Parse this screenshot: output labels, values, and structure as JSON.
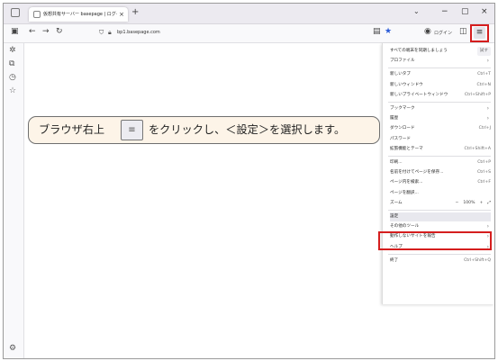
{
  "browser": {
    "tab_title": "仮想共有サーバー basepage | ログイン",
    "tab_close": "×",
    "new_tab": "+",
    "list_tabs_icon": "chevron-down-icon",
    "window_controls": [
      "−",
      "▢",
      "×"
    ],
    "url": "bp1.basepage.com",
    "account_label": "ログイン",
    "menu_icon": "≡"
  },
  "sidebar": {
    "icons": [
      "sparkle-icon",
      "tabs-sync-icon",
      "history-icon",
      "bookmark-star-icon"
    ],
    "bottom_icon": "gear-icon"
  },
  "menu": {
    "items": [
      {
        "label": "すべての端末を同期しましょう",
        "shortcut": "試す"
      },
      {
        "label": "プロファイル",
        "chevron": true
      },
      {
        "sep": true
      },
      {
        "label": "新しいタブ",
        "shortcut": "Ctrl+T"
      },
      {
        "label": "新しいウィンドウ",
        "shortcut": "Ctrl+N"
      },
      {
        "label": "新しいプライベートウィンドウ",
        "shortcut": "Ctrl+Shift+P"
      },
      {
        "sep": true
      },
      {
        "label": "ブックマーク",
        "chevron": true
      },
      {
        "label": "履歴",
        "chevron": true
      },
      {
        "label": "ダウンロード",
        "shortcut": "Ctrl+J"
      },
      {
        "label": "パスワード"
      },
      {
        "label": "拡張機能とテーマ",
        "shortcut": "Ctrl+Shift+A"
      },
      {
        "sep": true
      },
      {
        "label": "印刷...",
        "shortcut": "Ctrl+P"
      },
      {
        "label": "名前を付けてページを保存...",
        "shortcut": "Ctrl+S"
      },
      {
        "label": "ページ内を検索...",
        "shortcut": "Ctrl+F"
      },
      {
        "label": "ページを翻訳..."
      },
      {
        "label": "ズーム",
        "zoom": {
          "minus": "−",
          "value": "100%",
          "plus": "+",
          "fullscreen": "⤢"
        }
      },
      {
        "sep": true
      },
      {
        "label": "設定",
        "selected": true
      },
      {
        "label": "その他のツール",
        "chevron": true
      },
      {
        "label": "動作しないサイトを報告",
        "chevron": true
      },
      {
        "label": "ヘルプ",
        "chevron": true
      },
      {
        "sep": true
      },
      {
        "label": "終了",
        "shortcut": "Ctrl+Shift+Q"
      }
    ]
  },
  "callout": {
    "text_before": "ブラウザ右上",
    "icon_text": "≡",
    "text_after": "をクリックし、＜設定＞を選択します。"
  },
  "colors": {
    "highlight": "#d51e1e",
    "callout_bg": "#fdf4e8"
  }
}
